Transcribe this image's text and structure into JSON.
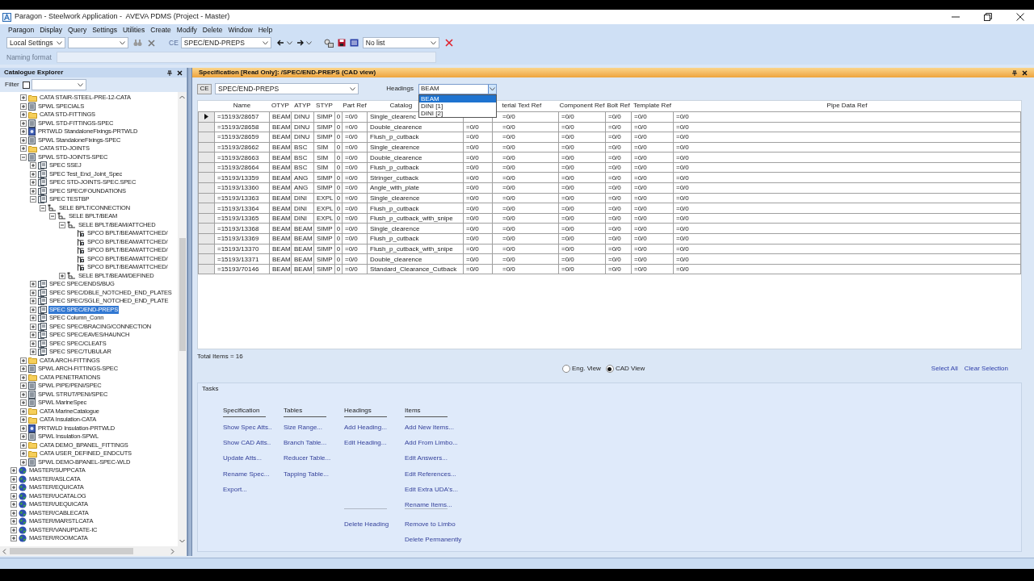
{
  "window": {
    "title": "Paragon - Steelwork Application -  AVEVA PDMS (Project - Master)"
  },
  "menu": [
    "Paragon",
    "Display",
    "Query",
    "Settings",
    "Utilities",
    "Create",
    "Modify",
    "Delete",
    "Window",
    "Help"
  ],
  "toolbar": {
    "settings": "Local Settings",
    "ce_label": "CE",
    "ce_value": "SPEC/END-PREPS",
    "list": "No list"
  },
  "naming_format": {
    "label": "Naming format"
  },
  "explorer": {
    "title": "Catalogue Explorer",
    "filter": {
      "label": "Filter",
      "checked": false
    },
    "tree": {
      "continued_items": [
        {
          "label": "CATA STAIR-STEEL-PRE-12-CATA",
          "kind": "folder",
          "expanded": false
        },
        {
          "label": "SPWL SPECIALS",
          "kind": "spwl",
          "expanded": false
        },
        {
          "label": "CATA STD-FITTINGS",
          "kind": "folder",
          "expanded": false
        },
        {
          "label": "SPWL STD-FITTINGS-SPEC",
          "kind": "spwl",
          "expanded": false
        },
        {
          "label": "PRTWLD StandaloneFixings-PRTWLD",
          "kind": "prtwld",
          "expanded": false
        },
        {
          "label": "SPWL StandaloneFixings-SPEC",
          "kind": "spwl",
          "expanded": false
        },
        {
          "label": "CATA STD-JOINTS",
          "kind": "folder",
          "expanded": false
        },
        {
          "label": "SPWL STD-JOINTS-SPEC",
          "kind": "spwl",
          "expanded": true,
          "children": [
            {
              "label": "SPEC SSEJ",
              "kind": "spec",
              "expanded": false
            },
            {
              "label": "SPEC Test_End_Joint_Spec",
              "kind": "spec",
              "expanded": false
            },
            {
              "label": "SPEC STD-JOINTS-SPEC.SPEC",
              "kind": "spec",
              "expanded": false
            },
            {
              "label": "SPEC SPEC/FOUNDATIONS",
              "kind": "spec",
              "expanded": false
            },
            {
              "label": "SPEC TESTBP",
              "kind": "spec",
              "expanded": true,
              "children": [
                {
                  "label": "SELE BPLT/CONNECTION",
                  "kind": "sele",
                  "expanded": true,
                  "children": [
                    {
                      "label": "SELE BPLT/BEAM",
                      "kind": "sele",
                      "expanded": true,
                      "children": [
                        {
                          "label": "SELE BPLT/BEAM/ATTCHED",
                          "kind": "sele",
                          "expanded": true,
                          "children": [
                            {
                              "label": "SPCO BPLT/BEAM/ATTCHED/",
                              "kind": "spco"
                            },
                            {
                              "label": "SPCO BPLT/BEAM/ATTCHED/",
                              "kind": "spco"
                            },
                            {
                              "label": "SPCO BPLT/BEAM/ATTCHED/",
                              "kind": "spco"
                            },
                            {
                              "label": "SPCO BPLT/BEAM/ATTCHED/",
                              "kind": "spco"
                            },
                            {
                              "label": "SPCO BPLT/BEAM/ATTCHED/",
                              "kind": "spco"
                            }
                          ]
                        },
                        {
                          "label": "SELE BPLT/BEAM/DEFINED",
                          "kind": "sele",
                          "expanded": false
                        }
                      ]
                    }
                  ]
                }
              ]
            },
            {
              "label": "SPEC SPEC/ENDS/BUG",
              "kind": "spec",
              "expanded": false
            },
            {
              "label": "SPEC SPEC/DBLE_NOTCHED_END_PLATES",
              "kind": "spec",
              "expanded": false
            },
            {
              "label": "SPEC SPEC/SGLE_NOTCHED_END_PLATE",
              "kind": "spec",
              "expanded": false
            },
            {
              "label": "SPEC SPEC/END-PREPS",
              "kind": "spec",
              "expanded": false,
              "selected": true
            },
            {
              "label": "SPEC Column_Conn",
              "kind": "spec",
              "expanded": false
            },
            {
              "label": "SPEC SPEC/BRACING/CONNECTION",
              "kind": "spec",
              "expanded": false
            },
            {
              "label": "SPEC SPEC/EAVES/HAUNCH",
              "kind": "spec",
              "expanded": false
            },
            {
              "label": "SPEC SPEC/CLEATS",
              "kind": "spec",
              "expanded": false
            },
            {
              "label": "SPEC SPEC/TUBULAR",
              "kind": "spec",
              "expanded": false
            }
          ]
        },
        {
          "label": "CATA ARCH-FITTINGS",
          "kind": "folder",
          "expanded": false
        },
        {
          "label": "SPWL ARCH-FITTINGS-SPEC",
          "kind": "spwl",
          "expanded": false
        },
        {
          "label": "CATA PENETRATIONS",
          "kind": "folder",
          "expanded": false
        },
        {
          "label": "SPWL PIPE/PENI/SPEC",
          "kind": "spwl",
          "expanded": false
        },
        {
          "label": "SPWL STRUT/PENI/SPEC",
          "kind": "spwl",
          "expanded": false
        },
        {
          "label": "SPWL MarineSpec",
          "kind": "spwl",
          "expanded": false
        },
        {
          "label": "CATA MarineCatalogue",
          "kind": "folder",
          "expanded": false
        },
        {
          "label": "CATA Insulation-CATA",
          "kind": "folder",
          "expanded": false
        },
        {
          "label": "PRTWLD Insulation-PRTWLD",
          "kind": "prtwld",
          "expanded": false
        },
        {
          "label": "SPWL Insulation-SPWL",
          "kind": "spwl",
          "expanded": false
        },
        {
          "label": "CATA DEMO_BPANEL_FITTINGS",
          "kind": "folder",
          "expanded": false
        },
        {
          "label": "CATA USER_DEFINED_ENDCUTS",
          "kind": "folder",
          "expanded": false
        },
        {
          "label": "SPWL DEMO-BPANEL-SPEC-WLD",
          "kind": "spwl",
          "expanded": false
        }
      ],
      "root_items": [
        {
          "label": "MASTER/SUPPCATA",
          "kind": "master",
          "expanded": false
        },
        {
          "label": "MASTER/ASLCATA",
          "kind": "master",
          "expanded": false
        },
        {
          "label": "MASTER/EQUICATA",
          "kind": "master",
          "expanded": false
        },
        {
          "label": "MASTER/UCATALOG",
          "kind": "master",
          "expanded": false
        },
        {
          "label": "MASTER/UEQUICATA",
          "kind": "master",
          "expanded": false
        },
        {
          "label": "MASTER/CABLECATA",
          "kind": "master",
          "expanded": false
        },
        {
          "label": "MASTER/MARSTLCATA",
          "kind": "master",
          "expanded": false
        },
        {
          "label": "MASTER/VANUPDATE-IC",
          "kind": "master",
          "expanded": false
        },
        {
          "label": "MASTER/ROOMCATA",
          "kind": "master",
          "expanded": false
        }
      ]
    }
  },
  "spec": {
    "title": "Specification [Read Only]: /SPEC/END-PREPS (CAD view)",
    "ce_button": "CE",
    "ce_value": "SPEC/END-PREPS",
    "headings": {
      "label": "Headings",
      "value": "BEAM",
      "open": true,
      "options": [
        {
          "label": "BEAM",
          "selected": true
        },
        {
          "label": "DINI [1]",
          "selected": false
        },
        {
          "label": "DINI [2]",
          "selected": false
        }
      ]
    },
    "table": {
      "columns": [
        "Name",
        "OTYP",
        "ATYP",
        "STYP",
        null,
        "Part Ref",
        "Catalog",
        null,
        "terial Text Ref",
        "Component Ref",
        "Bolt Ref",
        "Template Ref",
        "Pipe Data Ref"
      ],
      "rows": [
        {
          "current": true,
          "cells": [
            "=15193/28657",
            "BEAM",
            "DINU",
            "SIMP",
            "0",
            "=0/0",
            "Single_clearenc",
            null,
            "=0/0",
            "=0/0",
            "=0/0",
            "=0/0",
            "=0/0"
          ]
        },
        {
          "current": false,
          "cells": [
            "=15193/28658",
            "BEAM",
            "DINU",
            "SIMP",
            "0",
            "=0/0",
            "Double_clearence",
            "=0/0",
            "=0/0",
            "=0/0",
            "=0/0",
            "=0/0",
            "=0/0"
          ]
        },
        {
          "current": false,
          "cells": [
            "=15193/28659",
            "BEAM",
            "DINU",
            "SIMP",
            "0",
            "=0/0",
            "Flush_p_cutback",
            "=0/0",
            "=0/0",
            "=0/0",
            "=0/0",
            "=0/0",
            "=0/0"
          ]
        },
        {
          "current": false,
          "cells": [
            "=15193/28662",
            "BEAM",
            "BSC",
            "SIM",
            "0",
            "=0/0",
            "Single_clearence",
            "=0/0",
            "=0/0",
            "=0/0",
            "=0/0",
            "=0/0",
            "=0/0"
          ]
        },
        {
          "current": false,
          "cells": [
            "=15193/28663",
            "BEAM",
            "BSC",
            "SIM",
            "0",
            "=0/0",
            "Double_clearence",
            "=0/0",
            "=0/0",
            "=0/0",
            "=0/0",
            "=0/0",
            "=0/0"
          ]
        },
        {
          "current": false,
          "cells": [
            "=15193/28664",
            "BEAM",
            "BSC",
            "SIM",
            "0",
            "=0/0",
            "Flush_p_cutback",
            "=0/0",
            "=0/0",
            "=0/0",
            "=0/0",
            "=0/0",
            "=0/0"
          ]
        },
        {
          "current": false,
          "cells": [
            "=15193/13359",
            "BEAM",
            "ANG",
            "SIMP",
            "0",
            "=0/0",
            "Stringer_cutback",
            "=0/0",
            "=0/0",
            "=0/0",
            "=0/0",
            "=0/0",
            "=0/0"
          ]
        },
        {
          "current": false,
          "cells": [
            "=15193/13360",
            "BEAM",
            "ANG",
            "SIMP",
            "0",
            "=0/0",
            "Angle_with_plate",
            "=0/0",
            "=0/0",
            "=0/0",
            "=0/0",
            "=0/0",
            "=0/0"
          ]
        },
        {
          "current": false,
          "cells": [
            "=15193/13363",
            "BEAM",
            "DINI",
            "EXPL",
            "0",
            "=0/0",
            "Single_clearence",
            "=0/0",
            "=0/0",
            "=0/0",
            "=0/0",
            "=0/0",
            "=0/0"
          ]
        },
        {
          "current": false,
          "cells": [
            "=15193/13364",
            "BEAM",
            "DINI",
            "EXPL",
            "0",
            "=0/0",
            "Flush_p_cutback",
            "=0/0",
            "=0/0",
            "=0/0",
            "=0/0",
            "=0/0",
            "=0/0"
          ]
        },
        {
          "current": false,
          "cells": [
            "=15193/13365",
            "BEAM",
            "DINI",
            "EXPL",
            "0",
            "=0/0",
            "Flush_p_cutback_with_snipe",
            "=0/0",
            "=0/0",
            "=0/0",
            "=0/0",
            "=0/0",
            "=0/0"
          ]
        },
        {
          "current": false,
          "cells": [
            "=15193/13368",
            "BEAM",
            "BEAM",
            "SIMP",
            "0",
            "=0/0",
            "Single_clearence",
            "=0/0",
            "=0/0",
            "=0/0",
            "=0/0",
            "=0/0",
            "=0/0"
          ]
        },
        {
          "current": false,
          "cells": [
            "=15193/13369",
            "BEAM",
            "BEAM",
            "SIMP",
            "0",
            "=0/0",
            "Flush_p_cutback",
            "=0/0",
            "=0/0",
            "=0/0",
            "=0/0",
            "=0/0",
            "=0/0"
          ]
        },
        {
          "current": false,
          "cells": [
            "=15193/13370",
            "BEAM",
            "BEAM",
            "SIMP",
            "0",
            "=0/0",
            "Flush_p_cutback_with_snipe",
            "=0/0",
            "=0/0",
            "=0/0",
            "=0/0",
            "=0/0",
            "=0/0"
          ]
        },
        {
          "current": false,
          "cells": [
            "=15193/13371",
            "BEAM",
            "BEAM",
            "SIMP",
            "0",
            "=0/0",
            "Double_clearence",
            "=0/0",
            "=0/0",
            "=0/0",
            "=0/0",
            "=0/0",
            "=0/0"
          ]
        },
        {
          "current": false,
          "cells": [
            "=15193/70146",
            "BEAM",
            "BEAM",
            "SIMP",
            "0",
            "=0/0",
            "Standard_Clearance_Cutback",
            "=0/0",
            "=0/0",
            "=0/0",
            "=0/0",
            "=0/0",
            "=0/0"
          ]
        }
      ]
    },
    "total": "Total Items = 16",
    "views": [
      {
        "label": "Eng. View",
        "selected": false
      },
      {
        "label": "CAD View",
        "selected": true
      }
    ],
    "selection_links": [
      "Select All",
      "Clear Selection"
    ],
    "tasks": {
      "title": "Tasks",
      "groups": [
        {
          "heading": "Specification",
          "links": [
            "Show Spec Atts..",
            "Show CAD Atts..",
            "Update Atts...",
            "Rename Spec...",
            "Export..."
          ]
        },
        {
          "heading": "Tables",
          "links": [
            "Size Range...",
            "Branch Table...",
            "Reducer Table...",
            "Tapping Table..."
          ]
        },
        {
          "heading": "Headings",
          "links": [
            "Add Heading...",
            "Edit Heading..."
          ],
          "lower_links": [
            "Delete Heading"
          ]
        },
        {
          "heading": "Items",
          "links": [
            "Add New Items...",
            "Add From Limbo...",
            "Edit Answers...",
            "Edit References...",
            "Edit Extra UDA's...",
            "Rename Items..."
          ],
          "lower_links": [
            "Remove to Limbo",
            "Delete Permanently"
          ]
        }
      ]
    }
  }
}
